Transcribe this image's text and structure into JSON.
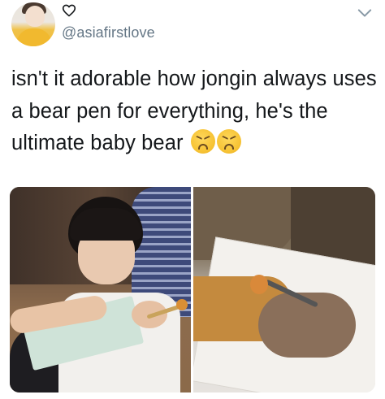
{
  "user": {
    "handle": "@asiafirstlove",
    "avatar_icon": "user-avatar"
  },
  "header": {
    "like_icon": "heart-outline-icon",
    "menu_icon": "chevron-down-icon"
  },
  "tweet": {
    "text": "isn't it adorable how jongin always uses a bear pen for everything, he's the ultimate baby bear",
    "emojis": [
      "tired-face-emoji",
      "tired-face-emoji"
    ]
  },
  "media": {
    "photos": [
      {
        "name": "photo-left"
      },
      {
        "name": "photo-right"
      }
    ]
  },
  "colors": {
    "text": "#14171a",
    "secondary": "#657786",
    "background": "#ffffff"
  }
}
